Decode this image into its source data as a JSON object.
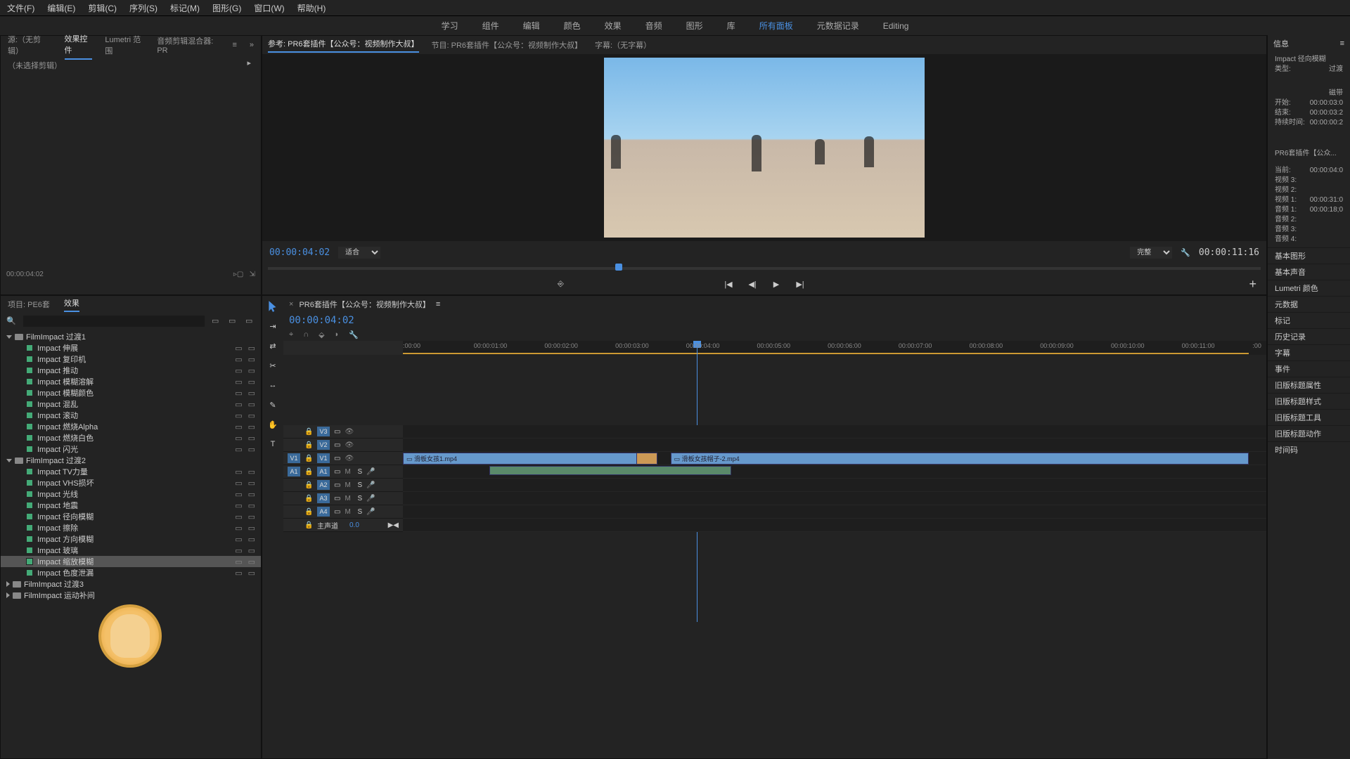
{
  "menu": [
    "文件(F)",
    "编辑(E)",
    "剪辑(C)",
    "序列(S)",
    "标记(M)",
    "图形(G)",
    "窗口(W)",
    "帮助(H)"
  ],
  "workspaces": [
    "学习",
    "组件",
    "编辑",
    "颜色",
    "效果",
    "音频",
    "图形",
    "库",
    "所有面板",
    "元数据记录",
    "Editing"
  ],
  "workspace_active": 8,
  "source": {
    "tabs": [
      "源:（无剪辑）",
      "效果控件",
      "Lumetri 范围",
      "音频剪辑混合器: PR"
    ],
    "active_tab": 1,
    "body": "（未选择剪辑）",
    "tc": "00:00:04:02"
  },
  "project": {
    "tabs": [
      "项目: PE6套",
      "效果"
    ],
    "active_tab": 1,
    "search_placeholder": "",
    "folders": [
      {
        "name": "FilmImpact 过渡1",
        "open": true,
        "items": [
          "Impact 伸展",
          "Impact 复印机",
          "Impact 推动",
          "Impact 模糊溶解",
          "Impact 模糊颜色",
          "Impact 混乱",
          "Impact 滚动",
          "Impact 燃烧Alpha",
          "Impact 燃烧白色",
          "Impact 闪光"
        ]
      },
      {
        "name": "FilmImpact 过渡2",
        "open": true,
        "items": [
          "Impact TV力量",
          "Impact VHS损坏",
          "Impact 光线",
          "Impact 地震",
          "Impact 径向模糊",
          "Impact 擦除",
          "Impact 方向模糊",
          "Impact 玻璃",
          "Impact 缩放模糊",
          "Impact 色度泄漏"
        ]
      },
      {
        "name": "FilmImpact 过渡3",
        "open": false,
        "items": []
      },
      {
        "name": "FilmImpact 运动补间",
        "open": false,
        "items": []
      }
    ],
    "selected_item": "Impact 缩放模糊"
  },
  "program": {
    "ref_tab": "参考: PR6套插件【公众号：视频制作大叔】",
    "prog_tab": "节目: PR6套插件【公众号：视频制作大叔】",
    "caption_tab": "字幕:（无字幕）",
    "tc_left": "00:00:04:02",
    "zoom_left": "适合",
    "zoom_right": "完整",
    "tc_right": "00:00:11:16"
  },
  "timeline": {
    "seq_name": "PR6套插件【公众号：视频制作大叔】",
    "tc": "00:00:04:02",
    "ruler": [
      ":00:00",
      "00:00:01:00",
      "00:00:02:00",
      "00:00:03:00",
      "00:00:04:00",
      "00:00:05:00",
      "00:00:06:00",
      "00:00:07:00",
      "00:00:08:00",
      "00:00:09:00",
      "00:00:10:00",
      "00:00:11:00",
      ":00"
    ],
    "video_tracks": [
      "V3",
      "V2",
      "V1"
    ],
    "audio_tracks": [
      "A1",
      "A2",
      "A3",
      "A4"
    ],
    "master": "主声道",
    "master_val": "0.0",
    "clip1": "滑板女孩1.mp4",
    "clip2": "滑板女孩帽子-2.mp4"
  },
  "info": {
    "title": "信息",
    "effect_name": "Impact 径向模糊",
    "effect_type_label": "类型:",
    "effect_type": "过渡",
    "tape": "磁带",
    "start_label": "开始:",
    "start": "00:00:03:0",
    "end_label": "结束:",
    "end": "00:00:03:2",
    "dur_label": "持续时间:",
    "dur": "00:00:00:2",
    "seq_name": "PR6套插件【公众...",
    "current_label": "当前:",
    "current": "00:00:04:0",
    "v3": "视频 3:",
    "v2": "视频 2:",
    "v1_label": "视频 1:",
    "v1": "00:00:31:0",
    "a1_label": "音频 1:",
    "a1": "00:00:18;0",
    "a2": "音频 2:",
    "a3": "音频 3:",
    "a4": "音频 4:"
  },
  "right_panels": [
    "基本图形",
    "基本声音",
    "Lumetri 颜色",
    "元数据",
    "标记",
    "历史记录",
    "字幕",
    "事件",
    "旧版标题属性",
    "旧版标题样式",
    "旧版标题工具",
    "旧版标题动作",
    "时间码"
  ]
}
